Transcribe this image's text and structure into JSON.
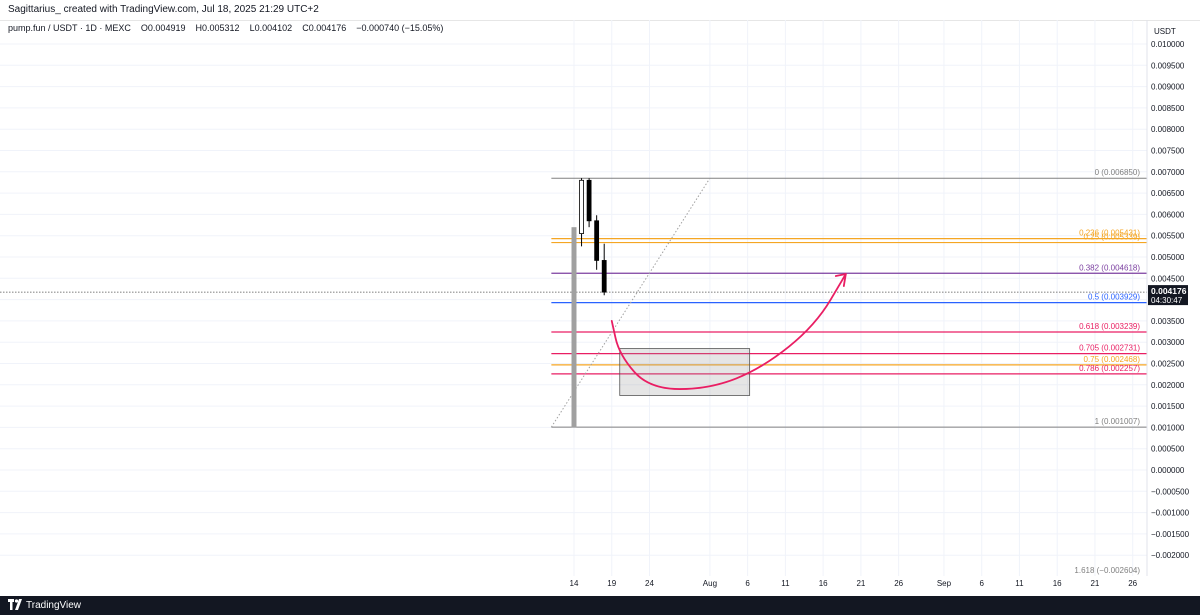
{
  "header": {
    "title": "Sagittarius_ created with TradingView.com, Jul 18, 2025 21:29 UTC+2"
  },
  "symbol_info": {
    "symbol": "pump.fun / USDT · 1D · MEXC",
    "open": "O0.004919",
    "high": "H0.005312",
    "low": "L0.004102",
    "close": "C0.004176",
    "change": "−0.000740 (−15.05%)"
  },
  "footer": {
    "brand": "TradingView"
  },
  "colors": {
    "candle_up": "#ffffff",
    "candle_down": "#000000",
    "gray_bar": "#a0a0a0",
    "fib_0": "#808080",
    "fib_0236": "#f5a623",
    "fib_0382": "#7b3fa0",
    "fib_05": "#2962ff",
    "fib_0618": "#e91e63",
    "fib_075": "#f5a623",
    "fib_1": "#808080",
    "arrow": "#e91e63",
    "price_badge": "#131722"
  },
  "chart_data": {
    "type": "candlestick",
    "y_unit": "USDT",
    "ylim": [
      -0.0022,
      0.0102
    ],
    "y_ticks": [
      "0.010000",
      "0.009500",
      "0.009000",
      "0.008500",
      "0.008000",
      "0.007500",
      "0.007000",
      "0.006500",
      "0.006000",
      "0.005500",
      "0.005000",
      "0.004500",
      "0.004000",
      "0.003500",
      "0.003000",
      "0.002500",
      "0.002000",
      "0.001500",
      "0.001000",
      "0.000500",
      "0.000000",
      "−0.000500",
      "−0.001000",
      "−0.001500",
      "−0.002000"
    ],
    "y_tick_values": [
      0.01,
      0.0095,
      0.009,
      0.0085,
      0.008,
      0.0075,
      0.007,
      0.0065,
      0.006,
      0.0055,
      0.005,
      0.0045,
      0.004,
      0.0035,
      0.003,
      0.0025,
      0.002,
      0.0015,
      0.001,
      0.0005,
      0.0,
      -0.0005,
      -0.001,
      -0.0015,
      -0.002
    ],
    "x_ticks": [
      {
        "label": "14",
        "date": "2025-07-14"
      },
      {
        "label": "19",
        "date": "2025-07-19"
      },
      {
        "label": "24",
        "date": "2025-07-24"
      },
      {
        "label": "Aug",
        "date": "2025-08-01"
      },
      {
        "label": "6",
        "date": "2025-08-06"
      },
      {
        "label": "11",
        "date": "2025-08-11"
      },
      {
        "label": "16",
        "date": "2025-08-16"
      },
      {
        "label": "21",
        "date": "2025-08-21"
      },
      {
        "label": "26",
        "date": "2025-08-26"
      },
      {
        "label": "Sep",
        "date": "2025-09-01"
      },
      {
        "label": "6",
        "date": "2025-09-06"
      },
      {
        "label": "11",
        "date": "2025-09-11"
      },
      {
        "label": "16",
        "date": "2025-09-16"
      },
      {
        "label": "21",
        "date": "2025-09-21"
      },
      {
        "label": "26",
        "date": "2025-09-26"
      }
    ],
    "candles": [
      {
        "date": "2025-07-14",
        "open": 0.0057,
        "high": 0.00575,
        "low": 0.001,
        "close": 0.001,
        "style": "gray"
      },
      {
        "date": "2025-07-15",
        "open": 0.00555,
        "high": 0.00685,
        "low": 0.00525,
        "close": 0.0068
      },
      {
        "date": "2025-07-16",
        "open": 0.0068,
        "high": 0.00685,
        "low": 0.0057,
        "close": 0.00585
      },
      {
        "date": "2025-07-17",
        "open": 0.00585,
        "high": 0.00598,
        "low": 0.0047,
        "close": 0.00492
      },
      {
        "date": "2025-07-18",
        "open": 0.004919,
        "high": 0.005312,
        "low": 0.004102,
        "close": 0.004176
      }
    ],
    "fib_levels": [
      {
        "ratio": "0",
        "label": "0 (0.006850)",
        "value": 0.00685,
        "color": "#808080"
      },
      {
        "ratio": "0.236",
        "label": "0.236 (0.005431)",
        "value": 0.005431,
        "color": "#f5a623"
      },
      {
        "ratio": "0.25",
        "label": "0.25 (0.005339)",
        "value": 0.005339,
        "color": "#f5a623"
      },
      {
        "ratio": "0.382",
        "label": "0.382 (0.004618)",
        "value": 0.004618,
        "color": "#7b3fa0"
      },
      {
        "ratio": "0.5",
        "label": "0.5 (0.003929)",
        "value": 0.003929,
        "color": "#2962ff"
      },
      {
        "ratio": "0.618",
        "label": "0.618 (0.003239)",
        "value": 0.003239,
        "color": "#e91e63"
      },
      {
        "ratio": "0.705",
        "label": "0.705 (0.002731)",
        "value": 0.002731,
        "color": "#e91e63"
      },
      {
        "ratio": "0.75",
        "label": "0.75 (0.002468)",
        "value": 0.002468,
        "color": "#f5a623"
      },
      {
        "ratio": "0.786",
        "label": "0.786 (0.002257)",
        "value": 0.002257,
        "color": "#e91e63"
      },
      {
        "ratio": "1",
        "label": "1 (0.001007)",
        "value": 0.001007,
        "color": "#808080"
      },
      {
        "ratio": "1.618",
        "label": "1.618 (−0.002604)",
        "value": -0.002604,
        "color": "#808080"
      }
    ],
    "fib_start_date": "2025-07-11",
    "current_price": {
      "value": 0.004176,
      "label": "0.004176",
      "countdown": "04:30:47"
    },
    "zone": {
      "date_start": "2025-07-19",
      "date_end": "2025-08-06",
      "top": 0.00285,
      "bottom": 0.00175
    },
    "arrow_path": [
      {
        "date": "2025-07-19",
        "value": 0.0035
      },
      {
        "date": "2025-07-20",
        "value": 0.0027
      },
      {
        "date": "2025-07-24",
        "value": 0.0019
      },
      {
        "date": "2025-08-01",
        "value": 0.0019
      },
      {
        "date": "2025-08-08",
        "value": 0.0024
      },
      {
        "date": "2025-08-15",
        "value": 0.0034
      },
      {
        "date": "2025-08-19",
        "value": 0.0046
      }
    ]
  }
}
